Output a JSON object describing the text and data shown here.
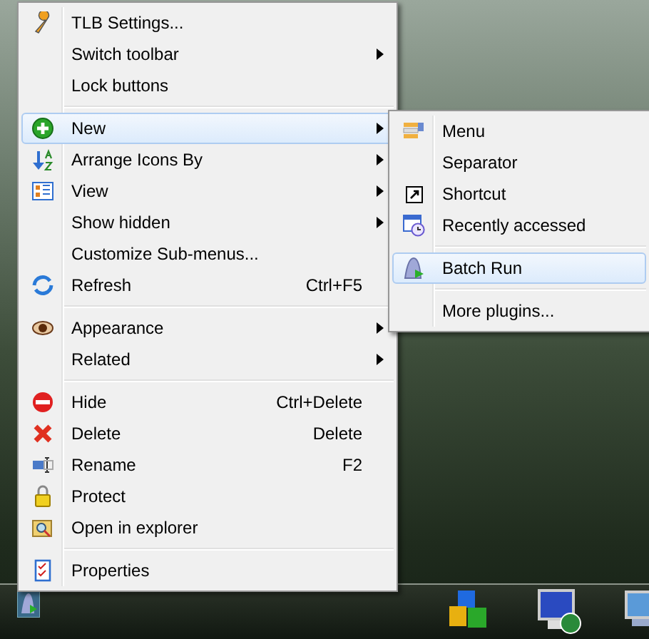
{
  "menu": {
    "items": [
      {
        "kind": "item",
        "label": "TLB Settings...",
        "has_submenu": false,
        "selected": false
      },
      {
        "kind": "item",
        "label": "Switch toolbar",
        "has_submenu": true,
        "selected": false
      },
      {
        "kind": "item",
        "label": "Lock buttons",
        "has_submenu": false,
        "selected": false
      },
      {
        "kind": "separator"
      },
      {
        "kind": "item",
        "label": "New",
        "has_submenu": true,
        "selected": true
      },
      {
        "kind": "item",
        "label": "Arrange Icons By",
        "has_submenu": true,
        "selected": false
      },
      {
        "kind": "item",
        "label": "View",
        "has_submenu": true,
        "selected": false
      },
      {
        "kind": "item",
        "label": "Show hidden",
        "has_submenu": true,
        "selected": false
      },
      {
        "kind": "item",
        "label": "Customize Sub-menus...",
        "has_submenu": false,
        "selected": false
      },
      {
        "kind": "item",
        "label": "Refresh",
        "shortcut": "Ctrl+F5",
        "has_submenu": false,
        "selected": false
      },
      {
        "kind": "separator"
      },
      {
        "kind": "item",
        "label": "Appearance",
        "has_submenu": true,
        "selected": false
      },
      {
        "kind": "item",
        "label": "Related",
        "has_submenu": true,
        "selected": false
      },
      {
        "kind": "separator"
      },
      {
        "kind": "item",
        "label": "Hide",
        "shortcut": "Ctrl+Delete",
        "has_submenu": false,
        "selected": false
      },
      {
        "kind": "item",
        "label": "Delete",
        "shortcut": "Delete",
        "has_submenu": false,
        "selected": false
      },
      {
        "kind": "item",
        "label": "Rename",
        "shortcut": "F2",
        "has_submenu": false,
        "selected": false
      },
      {
        "kind": "item",
        "label": "Protect",
        "has_submenu": false,
        "selected": false
      },
      {
        "kind": "item",
        "label": "Open in explorer",
        "has_submenu": false,
        "selected": false
      },
      {
        "kind": "separator"
      },
      {
        "kind": "item",
        "label": "Properties",
        "has_submenu": false,
        "selected": false
      }
    ]
  },
  "submenu": {
    "items": [
      {
        "kind": "item",
        "label": "Menu",
        "selected": false
      },
      {
        "kind": "item",
        "label": "Separator",
        "selected": false
      },
      {
        "kind": "item",
        "label": "Shortcut",
        "selected": false
      },
      {
        "kind": "item",
        "label": "Recently accessed",
        "selected": false
      },
      {
        "kind": "separator"
      },
      {
        "kind": "item",
        "label": "Batch Run",
        "selected": true
      },
      {
        "kind": "separator"
      },
      {
        "kind": "item",
        "label": "More plugins...",
        "selected": false
      }
    ]
  }
}
